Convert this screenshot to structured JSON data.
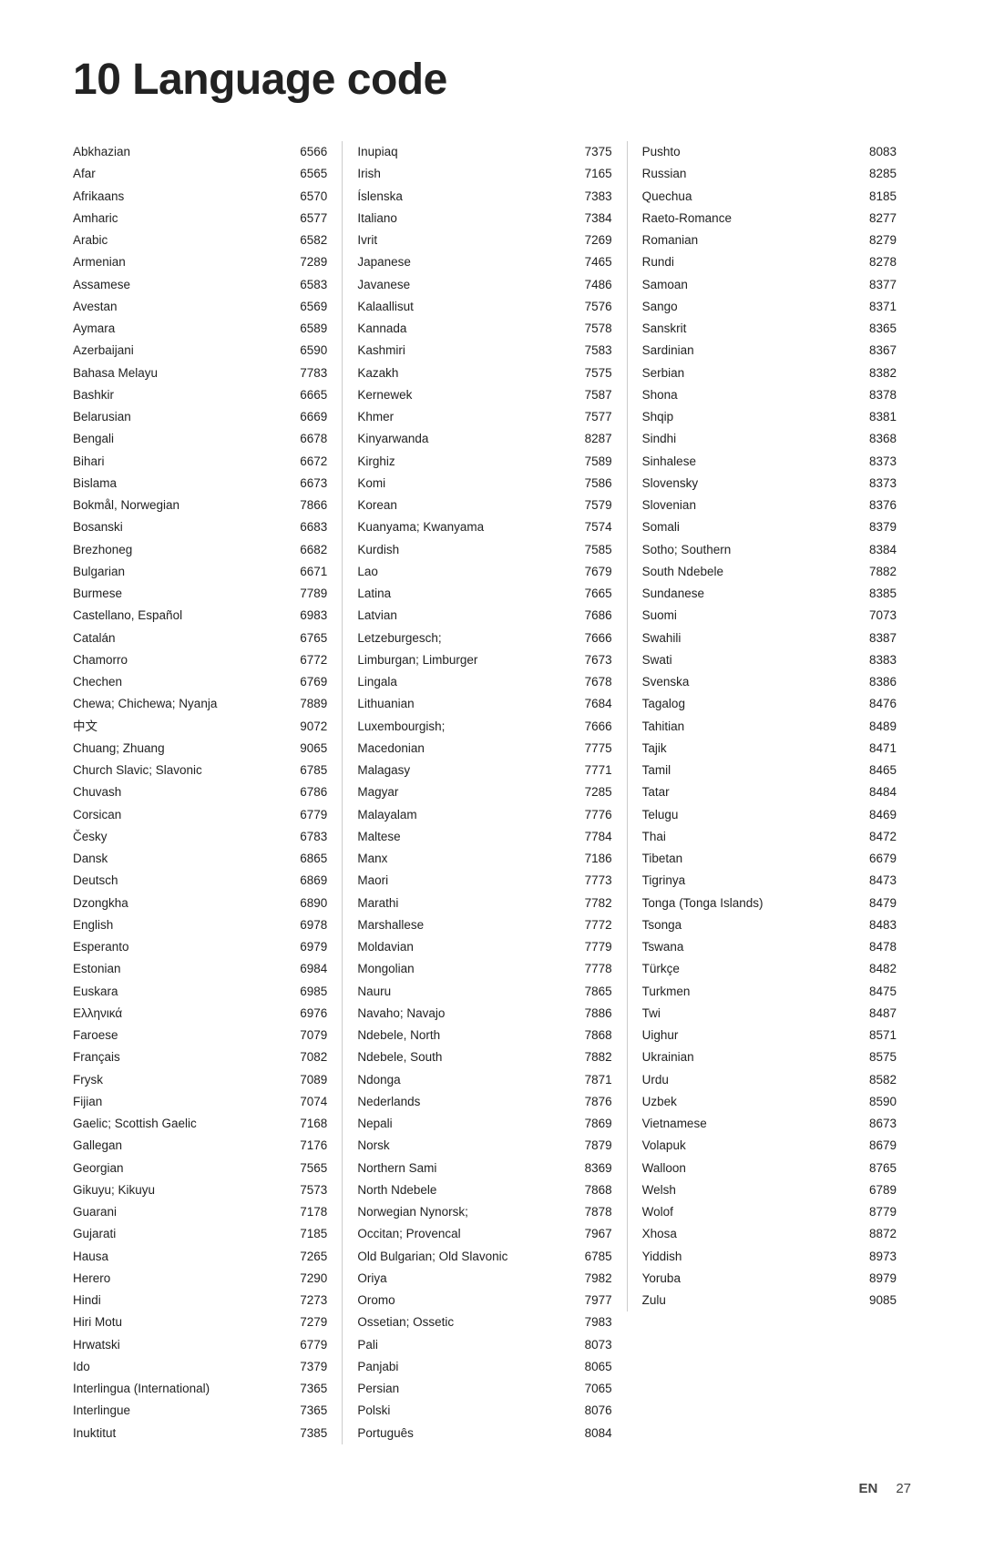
{
  "title": "10 Language code",
  "col1": [
    {
      "name": "Abkhazian",
      "code": "6566"
    },
    {
      "name": "Afar",
      "code": "6565"
    },
    {
      "name": "Afrikaans",
      "code": "6570"
    },
    {
      "name": "Amharic",
      "code": "6577"
    },
    {
      "name": "Arabic",
      "code": "6582"
    },
    {
      "name": "Armenian",
      "code": "7289"
    },
    {
      "name": "Assamese",
      "code": "6583"
    },
    {
      "name": "Avestan",
      "code": "6569"
    },
    {
      "name": "Aymara",
      "code": "6589"
    },
    {
      "name": "Azerbaijani",
      "code": "6590"
    },
    {
      "name": "Bahasa Melayu",
      "code": "7783"
    },
    {
      "name": "Bashkir",
      "code": "6665"
    },
    {
      "name": "Belarusian",
      "code": "6669"
    },
    {
      "name": "Bengali",
      "code": "6678"
    },
    {
      "name": "Bihari",
      "code": "6672"
    },
    {
      "name": "Bislama",
      "code": "6673"
    },
    {
      "name": "Bokmål, Norwegian",
      "code": "7866"
    },
    {
      "name": "Bosanski",
      "code": "6683"
    },
    {
      "name": "Brezhoneg",
      "code": "6682"
    },
    {
      "name": "Bulgarian",
      "code": "6671"
    },
    {
      "name": "Burmese",
      "code": "7789"
    },
    {
      "name": "Castellano, Español",
      "code": "6983"
    },
    {
      "name": "Catalán",
      "code": "6765"
    },
    {
      "name": "Chamorro",
      "code": "6772"
    },
    {
      "name": "Chechen",
      "code": "6769"
    },
    {
      "name": "Chewa; Chichewa; Nyanja",
      "code": "7889"
    },
    {
      "name": "中文",
      "code": "9072"
    },
    {
      "name": "Chuang; Zhuang",
      "code": "9065"
    },
    {
      "name": "Church Slavic; Slavonic",
      "code": "6785"
    },
    {
      "name": "Chuvash",
      "code": "6786"
    },
    {
      "name": "Corsican",
      "code": "6779"
    },
    {
      "name": "Česky",
      "code": "6783"
    },
    {
      "name": "Dansk",
      "code": "6865"
    },
    {
      "name": "Deutsch",
      "code": "6869"
    },
    {
      "name": "Dzongkha",
      "code": "6890"
    },
    {
      "name": "English",
      "code": "6978"
    },
    {
      "name": "Esperanto",
      "code": "6979"
    },
    {
      "name": "Estonian",
      "code": "6984"
    },
    {
      "name": "Euskara",
      "code": "6985"
    },
    {
      "name": "Ελληνικά",
      "code": "6976"
    },
    {
      "name": "Faroese",
      "code": "7079"
    },
    {
      "name": "Français",
      "code": "7082"
    },
    {
      "name": "Frysk",
      "code": "7089"
    },
    {
      "name": "Fijian",
      "code": "7074"
    },
    {
      "name": "Gaelic; Scottish Gaelic",
      "code": "7168"
    },
    {
      "name": "Gallegan",
      "code": "7176"
    },
    {
      "name": "Georgian",
      "code": "7565"
    },
    {
      "name": "Gikuyu; Kikuyu",
      "code": "7573"
    },
    {
      "name": "Guarani",
      "code": "7178"
    },
    {
      "name": "Gujarati",
      "code": "7185"
    },
    {
      "name": "Hausa",
      "code": "7265"
    },
    {
      "name": "Herero",
      "code": "7290"
    },
    {
      "name": "Hindi",
      "code": "7273"
    },
    {
      "name": "Hiri Motu",
      "code": "7279"
    },
    {
      "name": "Hrwatski",
      "code": "6779"
    },
    {
      "name": "Ido",
      "code": "7379"
    },
    {
      "name": "Interlingua (International)",
      "code": "7365"
    },
    {
      "name": "Interlingue",
      "code": "7365"
    },
    {
      "name": "Inuktitut",
      "code": "7385"
    }
  ],
  "col2": [
    {
      "name": "Inupiaq",
      "code": "7375"
    },
    {
      "name": "Irish",
      "code": "7165"
    },
    {
      "name": "Íslenska",
      "code": "7383"
    },
    {
      "name": "Italiano",
      "code": "7384"
    },
    {
      "name": "Ivrit",
      "code": "7269"
    },
    {
      "name": "Japanese",
      "code": "7465"
    },
    {
      "name": "Javanese",
      "code": "7486"
    },
    {
      "name": "Kalaallisut",
      "code": "7576"
    },
    {
      "name": "Kannada",
      "code": "7578"
    },
    {
      "name": "Kashmiri",
      "code": "7583"
    },
    {
      "name": "Kazakh",
      "code": "7575"
    },
    {
      "name": "Kernewek",
      "code": "7587"
    },
    {
      "name": "Khmer",
      "code": "7577"
    },
    {
      "name": "Kinyarwanda",
      "code": "8287"
    },
    {
      "name": "Kirghiz",
      "code": "7589"
    },
    {
      "name": "Komi",
      "code": "7586"
    },
    {
      "name": "Korean",
      "code": "7579"
    },
    {
      "name": "Kuanyama; Kwanyama",
      "code": "7574"
    },
    {
      "name": "Kurdish",
      "code": "7585"
    },
    {
      "name": "Lao",
      "code": "7679"
    },
    {
      "name": "Latina",
      "code": "7665"
    },
    {
      "name": "Latvian",
      "code": "7686"
    },
    {
      "name": "Letzeburgesch;",
      "code": "7666"
    },
    {
      "name": "Limburgan; Limburger",
      "code": "7673"
    },
    {
      "name": "Lingala",
      "code": "7678"
    },
    {
      "name": "Lithuanian",
      "code": "7684"
    },
    {
      "name": "Luxembourgish;",
      "code": "7666"
    },
    {
      "name": "Macedonian",
      "code": "7775"
    },
    {
      "name": "Malagasy",
      "code": "7771"
    },
    {
      "name": "Magyar",
      "code": "7285"
    },
    {
      "name": "Malayalam",
      "code": "7776"
    },
    {
      "name": "Maltese",
      "code": "7784"
    },
    {
      "name": "Manx",
      "code": "7186"
    },
    {
      "name": "Maori",
      "code": "7773"
    },
    {
      "name": "Marathi",
      "code": "7782"
    },
    {
      "name": "Marshallese",
      "code": "7772"
    },
    {
      "name": "Moldavian",
      "code": "7779"
    },
    {
      "name": "Mongolian",
      "code": "7778"
    },
    {
      "name": "Nauru",
      "code": "7865"
    },
    {
      "name": "Navaho; Navajo",
      "code": "7886"
    },
    {
      "name": "Ndebele, North",
      "code": "7868"
    },
    {
      "name": "Ndebele, South",
      "code": "7882"
    },
    {
      "name": "Ndonga",
      "code": "7871"
    },
    {
      "name": "Nederlands",
      "code": "7876"
    },
    {
      "name": "Nepali",
      "code": "7869"
    },
    {
      "name": "Norsk",
      "code": "7879"
    },
    {
      "name": "Northern Sami",
      "code": "8369"
    },
    {
      "name": "North Ndebele",
      "code": "7868"
    },
    {
      "name": "Norwegian Nynorsk;",
      "code": "7878"
    },
    {
      "name": "Occitan; Provencal",
      "code": "7967"
    },
    {
      "name": "Old Bulgarian; Old Slavonic",
      "code": "6785"
    },
    {
      "name": "Oriya",
      "code": "7982"
    },
    {
      "name": "Oromo",
      "code": "7977"
    },
    {
      "name": "Ossetian; Ossetic",
      "code": "7983"
    },
    {
      "name": "Pali",
      "code": "8073"
    },
    {
      "name": "Panjabi",
      "code": "8065"
    },
    {
      "name": "Persian",
      "code": "7065"
    },
    {
      "name": "Polski",
      "code": "8076"
    },
    {
      "name": "Português",
      "code": "8084"
    }
  ],
  "col3": [
    {
      "name": "Pushto",
      "code": "8083"
    },
    {
      "name": "Russian",
      "code": "8285"
    },
    {
      "name": "Quechua",
      "code": "8185"
    },
    {
      "name": "Raeto-Romance",
      "code": "8277"
    },
    {
      "name": "Romanian",
      "code": "8279"
    },
    {
      "name": "Rundi",
      "code": "8278"
    },
    {
      "name": "Samoan",
      "code": "8377"
    },
    {
      "name": "Sango",
      "code": "8371"
    },
    {
      "name": "Sanskrit",
      "code": "8365"
    },
    {
      "name": "Sardinian",
      "code": "8367"
    },
    {
      "name": "Serbian",
      "code": "8382"
    },
    {
      "name": "Shona",
      "code": "8378"
    },
    {
      "name": "Shqip",
      "code": "8381"
    },
    {
      "name": "Sindhi",
      "code": "8368"
    },
    {
      "name": "Sinhalese",
      "code": "8373"
    },
    {
      "name": "Slovensky",
      "code": "8373"
    },
    {
      "name": "Slovenian",
      "code": "8376"
    },
    {
      "name": "Somali",
      "code": "8379"
    },
    {
      "name": "Sotho; Southern",
      "code": "8384"
    },
    {
      "name": "South Ndebele",
      "code": "7882"
    },
    {
      "name": "Sundanese",
      "code": "8385"
    },
    {
      "name": "Suomi",
      "code": "7073"
    },
    {
      "name": "Swahili",
      "code": "8387"
    },
    {
      "name": "Swati",
      "code": "8383"
    },
    {
      "name": "Svenska",
      "code": "8386"
    },
    {
      "name": "Tagalog",
      "code": "8476"
    },
    {
      "name": "Tahitian",
      "code": "8489"
    },
    {
      "name": "Tajik",
      "code": "8471"
    },
    {
      "name": "Tamil",
      "code": "8465"
    },
    {
      "name": "Tatar",
      "code": "8484"
    },
    {
      "name": "Telugu",
      "code": "8469"
    },
    {
      "name": "Thai",
      "code": "8472"
    },
    {
      "name": "Tibetan",
      "code": "6679"
    },
    {
      "name": "Tigrinya",
      "code": "8473"
    },
    {
      "name": "Tonga (Tonga Islands)",
      "code": "8479"
    },
    {
      "name": "Tsonga",
      "code": "8483"
    },
    {
      "name": "Tswana",
      "code": "8478"
    },
    {
      "name": "Türkçe",
      "code": "8482"
    },
    {
      "name": "Turkmen",
      "code": "8475"
    },
    {
      "name": "Twi",
      "code": "8487"
    },
    {
      "name": "Uighur",
      "code": "8571"
    },
    {
      "name": "Ukrainian",
      "code": "8575"
    },
    {
      "name": "Urdu",
      "code": "8582"
    },
    {
      "name": "Uzbek",
      "code": "8590"
    },
    {
      "name": "Vietnamese",
      "code": "8673"
    },
    {
      "name": "Volapuk",
      "code": "8679"
    },
    {
      "name": "Walloon",
      "code": "8765"
    },
    {
      "name": "Welsh",
      "code": "6789"
    },
    {
      "name": "Wolof",
      "code": "8779"
    },
    {
      "name": "Xhosa",
      "code": "8872"
    },
    {
      "name": "Yiddish",
      "code": "8973"
    },
    {
      "name": "Yoruba",
      "code": "8979"
    },
    {
      "name": "Zulu",
      "code": "9085"
    }
  ],
  "footer": {
    "lang": "EN",
    "page": "27"
  }
}
